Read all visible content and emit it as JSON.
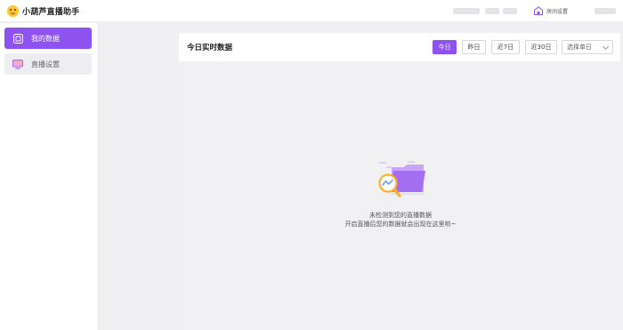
{
  "app": {
    "title": "小葫芦直播助手"
  },
  "header": {
    "room_settings_label": "房间设置"
  },
  "sidebar": {
    "items": [
      {
        "label": "我的数据",
        "icon": "data-chart-icon",
        "active": true
      },
      {
        "label": "直播设置",
        "icon": "monitor-icon",
        "active": false
      }
    ]
  },
  "panel": {
    "title": "今日实时数据",
    "filters": [
      "今日",
      "昨日",
      "近7日",
      "近30日"
    ],
    "active_filter": "今日",
    "select_placeholder": "选择单日"
  },
  "empty_state": {
    "illustration": "empty-folder-magnifier-icon",
    "line1": "未检测到您的直播数据",
    "line2": "开启直播后您的数据就会出现在这里哟~"
  },
  "colors": {
    "accent": "#8d52f0",
    "background": "#f0f0f2",
    "logo": "#ffc531"
  }
}
